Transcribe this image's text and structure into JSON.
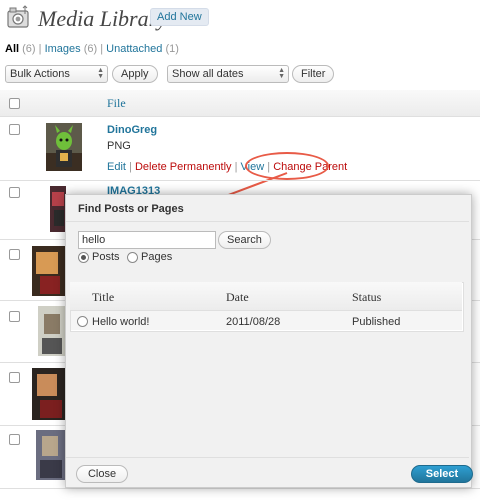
{
  "header": {
    "title": "Media Library",
    "add_new": "Add New"
  },
  "filters": {
    "all_label": "All",
    "all_count": "(6)",
    "images_label": "Images",
    "images_count": "(6)",
    "unattached_label": "Unattached",
    "unattached_count": "(1)",
    "separator": "|"
  },
  "toolbar": {
    "bulk_actions": "Bulk Actions",
    "apply": "Apply",
    "dates": "Show all dates",
    "filter": "Filter"
  },
  "table": {
    "column_file": "File",
    "rows": [
      {
        "name": "DinoGreg",
        "type": "PNG"
      },
      {
        "name": "IMAG1313"
      }
    ],
    "row_actions": {
      "edit": "Edit",
      "delete": "Delete Permanently",
      "view": "View",
      "change_parent": "Change Parent",
      "sep": "|"
    }
  },
  "modal": {
    "title": "Find Posts or Pages",
    "search_value": "hello",
    "search_button": "Search",
    "radio_posts": "Posts",
    "radio_pages": "Pages",
    "selected_radio": "posts",
    "columns": {
      "title": "Title",
      "date": "Date",
      "status": "Status"
    },
    "results": [
      {
        "title": "Hello world!",
        "date": "2011/08/28",
        "status": "Published"
      }
    ],
    "close": "Close",
    "select": "Select"
  },
  "colors": {
    "link": "#21759b",
    "delete": "#bc0b0b",
    "annotation": "#e85b47",
    "primary": "#21759b"
  }
}
